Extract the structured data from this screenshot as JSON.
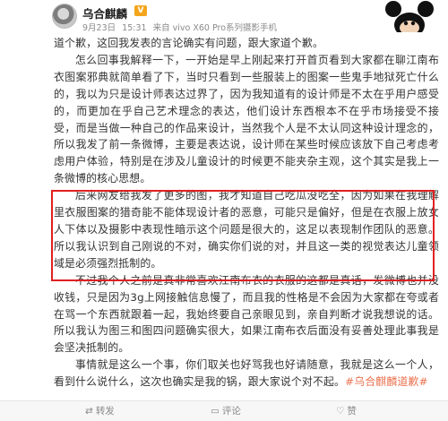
{
  "header": {
    "user_name": "乌合麒麟",
    "verified_badge": "V",
    "date": "9月23日",
    "time": "15:31",
    "source": "来自 vivo X60 Pro系列摄影手机"
  },
  "post": {
    "paragraphs": [
      "道个歉，这回我发表的言论确实有问题，跟大家道个歉。",
      "怎么回事我解释一下，一开始是早上刚起来打开首页看到大家都在聊江南布衣图案邪典就简单看了下，当时只看到一些服装上的图案一些鬼手地狱死亡什么的，我以为只是设计师表达过界了，因为我知道有的设计师是不太在乎用户感受的，而更加在乎自己艺术理念的表达，他们设计东西根本不在乎市场接受不接受，而是当做一种自己的作品来设计，当然我个人是不太认同这种设计理念的，所以我发了前一条微博，主要是表达说，设计师在某些时候应该放下自己考虑考虑用户体验，特别是在涉及儿童设计的时候更不能夹杂主观，这个其实是我上一条微博的核心思想。",
      "后来网友给我发了更多的图，我才知道自己吃瓜没吃全，因为如果在我理解里衣服图案的猎奇能不能体现设计者的恶意，可能只是偏好，但是在衣服上放女人下体以及摄影中表现性暗示这个问题是很大的，这足以表现制作团队的恶意。所以我认识到自己刚说的不对，确实你们说的对，并且这一类的视觉表达儿童领域是必须强烈抵制的。",
      "不过我个人之前是真非常喜欢江南布衣的衣服的这都是真话，发微博也并没收钱，只是因为3g上网接触信息慢了，而且我的性格是不会因为大家都在夸或者在骂一个东西就跟着一起，我始终要自己亲眼见到，亲自判断才说我想说的话。所以我认为图三和图四问题确实很大，如果江南布衣后面没有妥善处理此事我是会坚决抵制的。",
      "事情就是这么一个事，你们取关也好骂我也好请随意，我就是这么一个人，看到什么说什么，这次也确实是我的锅，跟大家说个对不起。"
    ],
    "hashtag": "#乌合麒麟道歉#"
  },
  "footer": {
    "repost": "转发",
    "comment": "评论",
    "like": "赞"
  },
  "colors": {
    "highlight_border": "#e02020",
    "hashtag": "#eb7350",
    "badge": "#f4a51c"
  }
}
